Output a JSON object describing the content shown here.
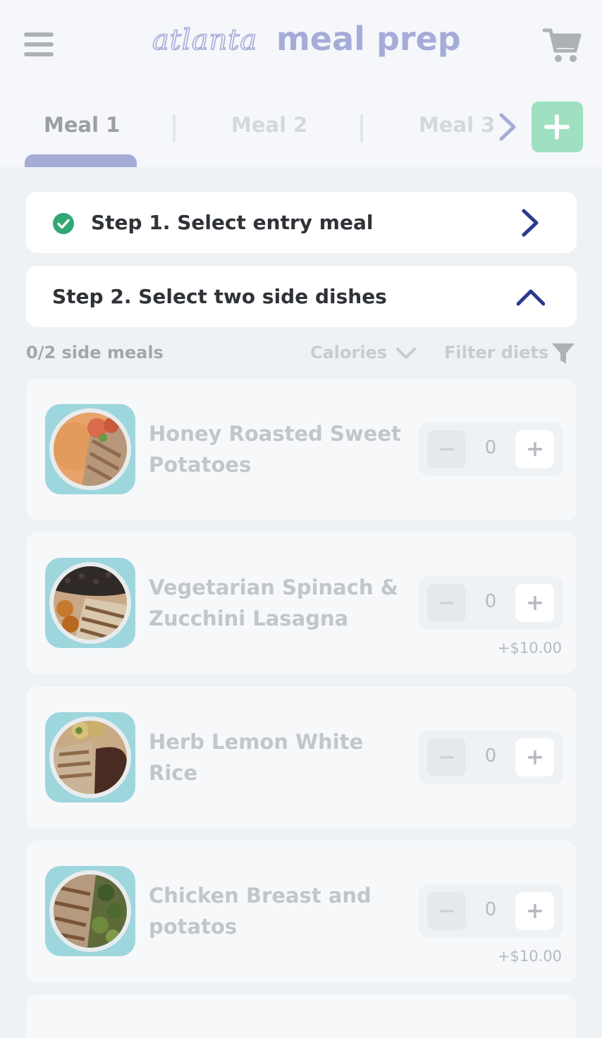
{
  "header": {
    "menu_icon": "hamburger-menu-icon",
    "logo_light": "atlanta",
    "logo_bold": "meal prep",
    "cart_icon": "shopping-cart-icon"
  },
  "tabs": {
    "items": [
      {
        "label": "Meal 1",
        "active": true
      },
      {
        "label": "Meal 2",
        "active": false
      },
      {
        "label": "Meal 3",
        "active": false
      }
    ],
    "next_icon": "chevron-right-icon",
    "add_icon": "plus-icon"
  },
  "steps": [
    {
      "title": "Step 1. Select entry meal",
      "completed": true,
      "icon": "check-circle-icon",
      "chevron": "chevron-right-icon"
    },
    {
      "title": "Step 2. Select two side dishes",
      "completed": false,
      "chevron": "chevron-up-icon"
    }
  ],
  "filters": {
    "count_text": "0/2 side meals",
    "sort_label": "Calories",
    "sort_icon": "chevron-down-icon",
    "filter_label": "Filter diets",
    "filter_icon": "funnel-icon"
  },
  "side_dishes": [
    {
      "name": "Honey Roasted Sweet Potatoes",
      "quantity": "0",
      "price": ""
    },
    {
      "name": "Vegetarian Spinach & Zucchini Lasagna",
      "quantity": "0",
      "price": "+$10.00"
    },
    {
      "name": "Herb Lemon White Rice",
      "quantity": "0",
      "price": ""
    },
    {
      "name": "Chicken Breast and potatos",
      "quantity": "0",
      "price": "+$10.00"
    }
  ],
  "colors": {
    "accent": "#a6acd8",
    "add_button": "#9ee0c0",
    "check": "#2fa874",
    "chevron": "#2b3a8c"
  }
}
